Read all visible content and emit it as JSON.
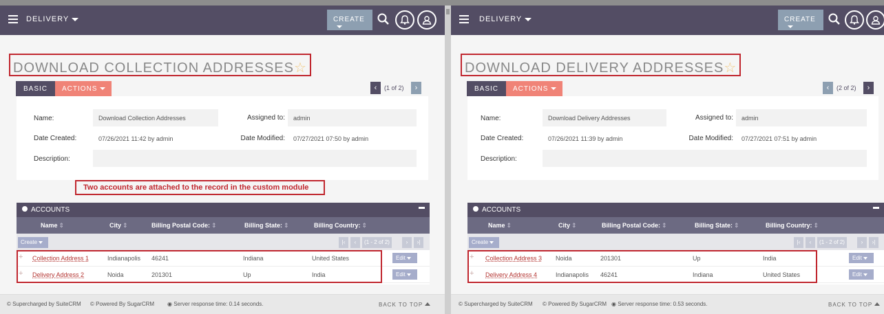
{
  "left": {
    "module": "DELIVERY",
    "create_label": "CREATE",
    "title": "DOWNLOAD COLLECTION ADDRESSES",
    "tabs": {
      "basic": "BASIC",
      "actions": "ACTIONS"
    },
    "pager": "(1 of 2)",
    "fields": {
      "name_label": "Name:",
      "name": "Download Collection Addresses",
      "assigned_label": "Assigned to:",
      "assigned": "admin",
      "created_label": "Date Created:",
      "created": "07/26/2021 11:42 by admin",
      "modified_label": "Date Modified:",
      "modified": "07/27/2021 07:50 by admin",
      "description_label": "Description:"
    },
    "annotation": "Two accounts are attached to the record in the custom module",
    "subpanel": {
      "title": "ACCOUNTS",
      "columns": [
        "Name",
        "City",
        "Billing Postal Code:",
        "Billing State:",
        "Billing Country:"
      ],
      "create_label": "Create",
      "range": "(1 - 2 of 2)",
      "edit_label": "Edit",
      "rows": [
        {
          "name": "Collection Address 1",
          "city": "Indianapolis",
          "postal": "46241",
          "state": "Indiana",
          "country": "United States"
        },
        {
          "name": "Delivery Address 2",
          "city": "Noida",
          "postal": "201301",
          "state": "Up",
          "country": "India"
        }
      ]
    },
    "footer": {
      "supercharged": "© Supercharged by SuiteCRM",
      "powered": "© Powered By SugarCRM",
      "response": "Server response time: 0.14 seconds.",
      "back_to_top": "BACK TO TOP"
    }
  },
  "right": {
    "module": "DELIVERY",
    "create_label": "CREATE",
    "title": "DOWNLOAD DELIVERY ADDRESSES",
    "tabs": {
      "basic": "BASIC",
      "actions": "ACTIONS"
    },
    "pager": "(2 of 2)",
    "fields": {
      "name_label": "Name:",
      "name": "Download Delivery Addresses",
      "assigned_label": "Assigned to:",
      "assigned": "admin",
      "created_label": "Date Created:",
      "created": "07/26/2021 11:39 by admin",
      "modified_label": "Date Modified:",
      "modified": "07/27/2021 07:51 by admin",
      "description_label": "Description:"
    },
    "subpanel": {
      "title": "ACCOUNTS",
      "columns": [
        "Name",
        "City",
        "Billing Postal Code:",
        "Billing State:",
        "Billing Country:"
      ],
      "create_label": "Create",
      "range": "(1 - 2 of 2)",
      "edit_label": "Edit",
      "rows": [
        {
          "name": "Collection Address 3",
          "city": "Noida",
          "postal": "201301",
          "state": "Up",
          "country": "India"
        },
        {
          "name": "Delivery Address 4",
          "city": "Indianapolis",
          "postal": "46241",
          "state": "Indiana",
          "country": "United States"
        }
      ]
    },
    "footer": {
      "supercharged": "© Supercharged by SuiteCRM",
      "powered": "© Powered By SugarCRM",
      "response": "Server response time: 0.53 seconds.",
      "back_to_top": "BACK TO TOP"
    }
  },
  "colors": {
    "topbar": "#534d64",
    "accent": "#f08377",
    "highlight": "#c0262e",
    "link": "#b3322f"
  },
  "icons": [
    "hamburger-icon",
    "search-icon",
    "notification-icon",
    "user-icon",
    "star-icon",
    "globe-icon"
  ]
}
